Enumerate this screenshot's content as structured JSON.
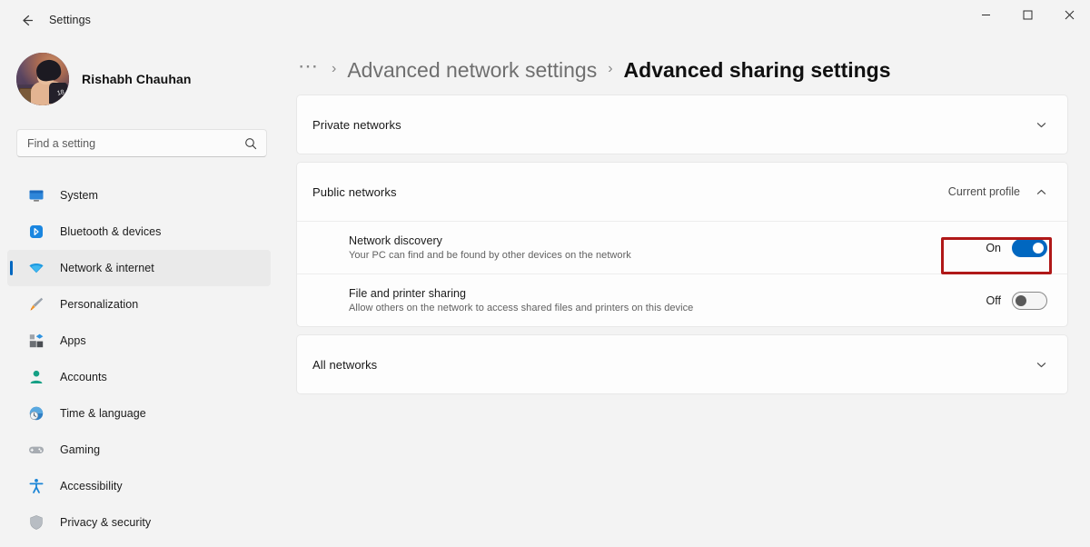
{
  "window": {
    "app_title": "Settings",
    "back_icon": "arrow-left-icon",
    "controls": {
      "minimize": "minimize-icon",
      "maximize": "maximize-icon",
      "close": "close-icon"
    }
  },
  "sidebar": {
    "profile": {
      "name": "Rishabh Chauhan",
      "avatar": "user-avatar",
      "avatar_badge": "18"
    },
    "search": {
      "placeholder": "Find a setting",
      "value": "",
      "icon": "search-icon"
    },
    "items": [
      {
        "label": "System",
        "icon": "monitor-icon",
        "selected": false
      },
      {
        "label": "Bluetooth & devices",
        "icon": "bluetooth-icon",
        "selected": false
      },
      {
        "label": "Network & internet",
        "icon": "wifi-icon",
        "selected": true
      },
      {
        "label": "Personalization",
        "icon": "paintbrush-icon",
        "selected": false
      },
      {
        "label": "Apps",
        "icon": "apps-icon",
        "selected": false
      },
      {
        "label": "Accounts",
        "icon": "person-icon",
        "selected": false
      },
      {
        "label": "Time & language",
        "icon": "clock-globe-icon",
        "selected": false
      },
      {
        "label": "Gaming",
        "icon": "gamepad-icon",
        "selected": false
      },
      {
        "label": "Accessibility",
        "icon": "accessibility-icon",
        "selected": false
      },
      {
        "label": "Privacy & security",
        "icon": "shield-icon",
        "selected": false
      }
    ]
  },
  "main": {
    "breadcrumb": {
      "ellipsis": "⋯",
      "separator": "›",
      "parent": "Advanced network settings",
      "current": "Advanced sharing settings"
    },
    "cards": {
      "private": {
        "title": "Private networks",
        "note": "",
        "chevron": "chevron-down-icon",
        "expanded": false
      },
      "public": {
        "title": "Public networks",
        "note": "Current profile",
        "chevron": "chevron-up-icon",
        "expanded": true,
        "rows": [
          {
            "title": "Network discovery",
            "subtitle": "Your PC can find and be found by other devices on the network",
            "toggle_label": "On",
            "toggle_state": "on",
            "highlighted": true
          },
          {
            "title": "File and printer sharing",
            "subtitle": "Allow others on the network to access shared files and printers on this device",
            "toggle_label": "Off",
            "toggle_state": "off",
            "highlighted": false
          }
        ]
      },
      "all": {
        "title": "All networks",
        "note": "",
        "chevron": "chevron-down-icon",
        "expanded": false
      }
    }
  },
  "colors": {
    "accent": "#0067c0",
    "highlight": "#b01818",
    "page_background": "#f3f3f3",
    "card_background": "#fdfdfd"
  }
}
